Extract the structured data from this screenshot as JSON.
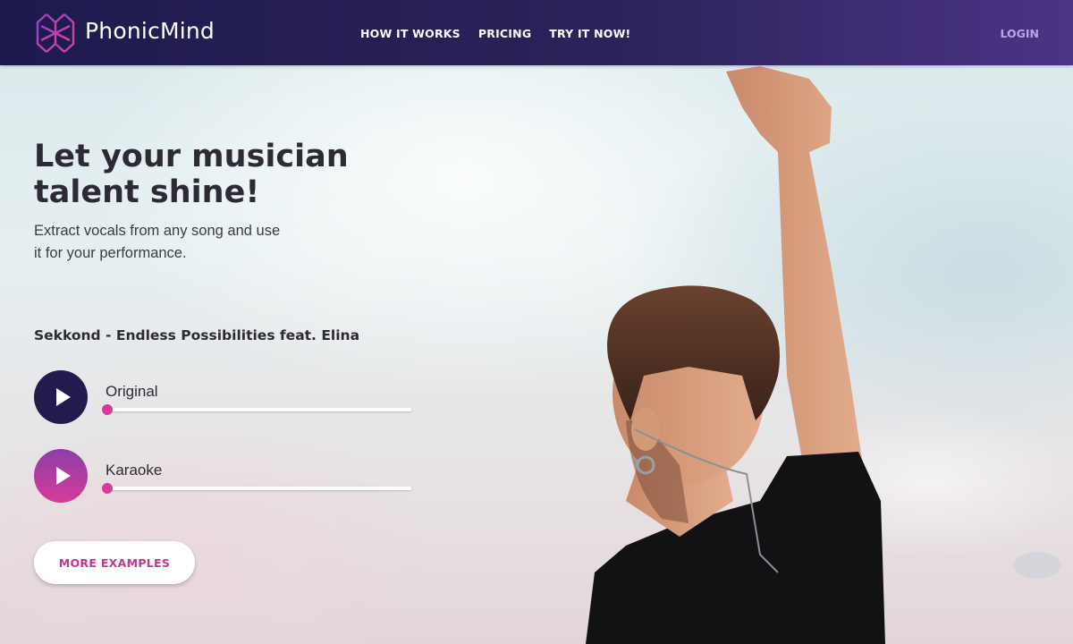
{
  "colors": {
    "nav_start": "#1e1a4e",
    "nav_end": "#4b3485",
    "accent_pink": "#d63b9a",
    "accent_purple": "#8c3ea8",
    "dark_button": "#231b4e",
    "login": "#b9a6e4",
    "heading_text": "#2e2a35"
  },
  "nav": {
    "brand": "PhonicMind",
    "logo_icon": "phonicmind-logo-icon",
    "links": [
      {
        "label": "HOW IT WORKS"
      },
      {
        "label": "PRICING"
      },
      {
        "label": "TRY IT NOW!"
      }
    ],
    "login": "LOGIN"
  },
  "hero": {
    "title_line1": "Let your musician",
    "title_line2": "talent shine!",
    "subtitle_line1": "Extract vocals from any song and use",
    "subtitle_line2": "it for your performance."
  },
  "demo": {
    "song": "Sekkond - Endless Possibilities feat. Elina",
    "players": [
      {
        "label": "Original",
        "icon": "play-icon",
        "progress": 0
      },
      {
        "label": "Karaoke",
        "icon": "play-icon",
        "progress": 0
      }
    ],
    "more_button": "MORE EXAMPLES"
  }
}
